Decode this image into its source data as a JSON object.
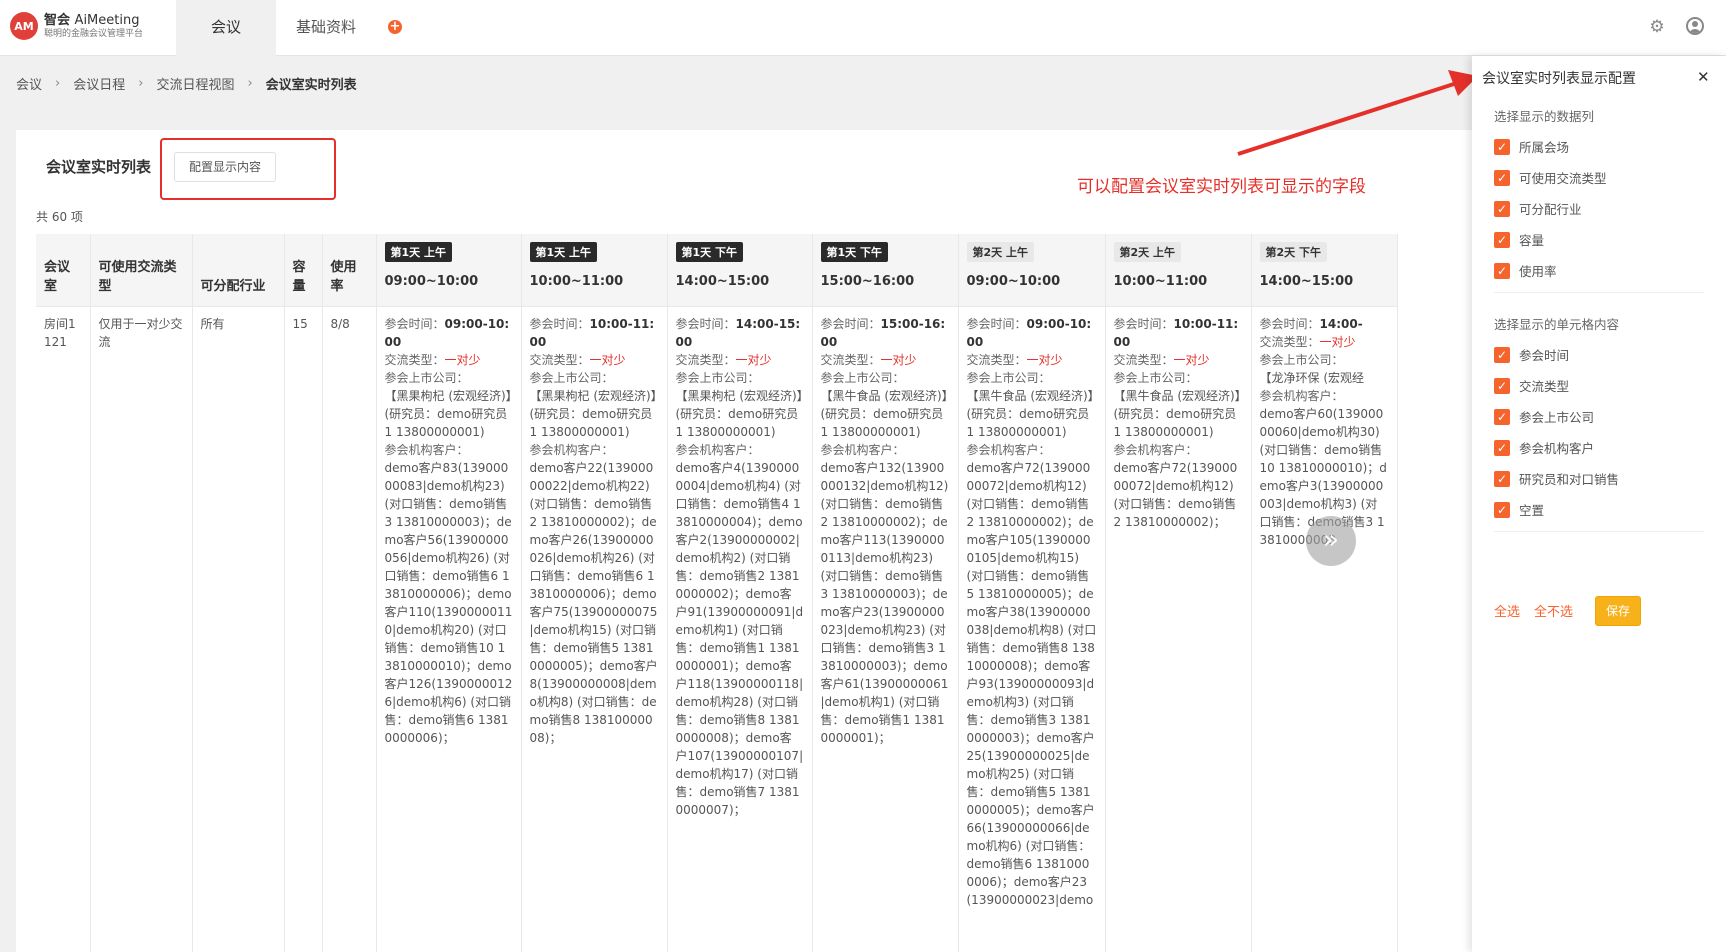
{
  "app": {
    "logo_mark": "AM",
    "name_cn": "智会",
    "name_en": "AiMeeting",
    "subtitle": "聪明的金融会议管理平台"
  },
  "nav": {
    "tabs": [
      {
        "label": "会议",
        "active": true
      },
      {
        "label": "基础资料",
        "active": false
      }
    ],
    "add_icon": "plus-circle-icon"
  },
  "header_icons": [
    "gear-icon",
    "user-icon"
  ],
  "breadcrumb": [
    "会议",
    "会议日程",
    "交流日程视图",
    "会议室实时列表"
  ],
  "page": {
    "title": "会议室实时列表",
    "config_button": "配置显示内容",
    "total": "共 60 项"
  },
  "table": {
    "headers": [
      "会议室",
      "可使用交流类型",
      "可分配行业",
      "容量",
      "使用率"
    ],
    "slots": [
      {
        "tag": "第1天 上午",
        "time": "09:00~10:00",
        "dark": true
      },
      {
        "tag": "第1天 上午",
        "time": "10:00~11:00",
        "dark": true
      },
      {
        "tag": "第1天 下午",
        "time": "14:00~15:00",
        "dark": true
      },
      {
        "tag": "第1天 下午",
        "time": "15:00~16:00",
        "dark": true
      },
      {
        "tag": "第2天 上午",
        "time": "09:00~10:00",
        "dark": false
      },
      {
        "tag": "第2天 上午",
        "time": "10:00~11:00",
        "dark": false
      },
      {
        "tag": "第2天 下午",
        "time": "14:00~15:00",
        "dark": false
      }
    ],
    "row": {
      "room": "房间1121",
      "types": "仅用于一对少交流",
      "industry": "所有",
      "capacity": "15",
      "usage": "8/8",
      "label_time": "参会时间：",
      "label_type": "交流类型：",
      "label_company": "参会上市公司：",
      "label_clients": "参会机构客户：",
      "cells": [
        {
          "time": "09:00-10:00",
          "type": "一对少",
          "company": "【黑果枸杞 (宏观经济)】(研究员：demo研究员1 13800000001)",
          "clients": "demo客户83(13900000083|demo机构23) (对口销售：demo销售3 13810000003)；demo客户56(13900000056|demo机构26) (对口销售：demo销售6 13810000006)；demo客户110(13900000110|demo机构20) (对口销售：demo销售10 13810000010)；demo客户126(13900000126|demo机构6) (对口销售：demo销售6 13810000006)；"
        },
        {
          "time": "10:00-11:00",
          "type": "一对少",
          "company": "【黑果枸杞 (宏观经济)】(研究员：demo研究员1 13800000001)",
          "clients": "demo客户22(13900000022|demo机构22) (对口销售：demo销售2 13810000002)；demo客户26(13900000026|demo机构26) (对口销售：demo销售6 13810000006)；demo客户75(13900000075|demo机构15) (对口销售：demo销售5 13810000005)；demo客户8(13900000008|demo机构8) (对口销售：demo销售8 13810000008)；"
        },
        {
          "time": "14:00-15:00",
          "type": "一对少",
          "company": "【黑果枸杞 (宏观经济)】(研究员：demo研究员1 13800000001)",
          "clients": "demo客户4(13900000004|demo机构4) (对口销售：demo销售4 13810000004)；demo客户2(13900000002|demo机构2) (对口销售：demo销售2 13810000002)；demo客户91(13900000091|demo机构1) (对口销售：demo销售1 13810000001)；demo客户118(13900000118|demo机构28) (对口销售：demo销售8 13810000008)；demo客户107(13900000107|demo机构17) (对口销售：demo销售7 13810000007)；"
        },
        {
          "time": "15:00-16:00",
          "type": "一对少",
          "company": "【黑牛食品 (宏观经济)】(研究员：demo研究员1 13800000001)",
          "clients": "demo客户132(13900000132|demo机构12) (对口销售：demo销售2 13810000002)；demo客户113(13900000113|demo机构23) (对口销售：demo销售3 13810000003)；demo客户23(13900000023|demo机构23) (对口销售：demo销售3 13810000003)；demo客户61(13900000061|demo机构1) (对口销售：demo销售1 13810000001)；"
        },
        {
          "time": "09:00-10:00",
          "type": "一对少",
          "company": "【黑牛食品 (宏观经济)】(研究员：demo研究员1 13800000001)",
          "clients": "demo客户72(13900000072|demo机构12) (对口销售：demo销售2 13810000002)；demo客户105(13900000105|demo机构15) (对口销售：demo销售5 13810000005)；demo客户38(13900000038|demo机构8) (对口销售：demo销售8 13810000008)；demo客户93(13900000093|demo机构3) (对口销售：demo销售3 13810000003)；demo客户25(13900000025|demo机构25) (对口销售：demo销售5 13810000005)；demo客户66(13900000066|demo机构6) (对口销售：demo销售6 13810000006)；demo客户23(13900000023|demo"
        },
        {
          "time": "10:00-11:00",
          "type": "一对少",
          "company": "【黑牛食品 (宏观经济)】(研究员：demo研究员1 13800000001)",
          "clients": "demo客户72(13900000072|demo机构12) (对口销售：demo销售2 13810000002)；"
        },
        {
          "time": "14:00-",
          "type": "一对少",
          "company": "【龙净环保 (宏观经",
          "clients": "demo客户60(13900000060|demo机构30) (对口销售：demo销售10 13810000010)；demo客户3(13900000003|demo机构3) (对口销售：demo销售3 13810000003"
        }
      ]
    }
  },
  "annotation": {
    "text": "可以配置会议室实时列表可显示的字段",
    "color": "#e5302a"
  },
  "panel": {
    "title": "会议室实时列表显示配置",
    "close_icon": "close-icon",
    "section1_title": "选择显示的数据列",
    "columns": [
      "所属会场",
      "可使用交流类型",
      "可分配行业",
      "容量",
      "使用率"
    ],
    "section2_title": "选择显示的单元格内容",
    "cell_items": [
      "参会时间",
      "交流类型",
      "参会上市公司",
      "参会机构客户",
      "研究员和对口销售",
      "空置"
    ],
    "select_all": "全选",
    "select_none": "全不选",
    "save": "保存"
  },
  "colors": {
    "accent": "#f5642d",
    "save": "#f7b21b",
    "highlight_red": "#e5302a"
  }
}
